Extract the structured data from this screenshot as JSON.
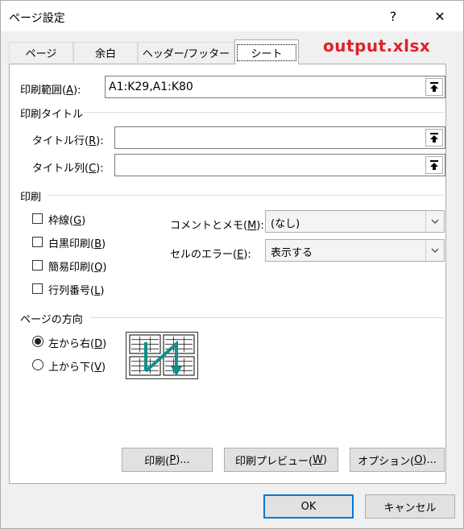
{
  "window": {
    "title": "ページ設定",
    "help_glyph": "?",
    "close_glyph": "✕"
  },
  "annotation": {
    "filename": "output.xlsx"
  },
  "tabs": [
    {
      "label": "ページ",
      "active": false
    },
    {
      "label": "余白",
      "active": false
    },
    {
      "label": "ヘッダー/フッター",
      "active": false
    },
    {
      "label": "シート",
      "active": true
    }
  ],
  "print_area": {
    "label_pre": "印刷範囲(",
    "accel": "A",
    "label_post": "):",
    "value": "A1:K29,A1:K80"
  },
  "print_titles": {
    "group_label": "印刷タイトル",
    "rows": {
      "label_pre": "タイトル行(",
      "accel": "R",
      "label_post": "):",
      "value": ""
    },
    "cols": {
      "label_pre": "タイトル列(",
      "accel": "C",
      "label_post": "):",
      "value": ""
    }
  },
  "print": {
    "group_label": "印刷",
    "options": [
      {
        "label_pre": "枠線(",
        "accel": "G",
        "label_post": ")",
        "checked": false
      },
      {
        "label_pre": "白黒印刷(",
        "accel": "B",
        "label_post": ")",
        "checked": false
      },
      {
        "label_pre": "簡易印刷(",
        "accel": "Q",
        "label_post": ")",
        "checked": false
      },
      {
        "label_pre": "行列番号(",
        "accel": "L",
        "label_post": ")",
        "checked": false
      }
    ],
    "comments": {
      "label_pre": "コメントとメモ(",
      "accel": "M",
      "label_post": "):",
      "value": "(なし)"
    },
    "errors": {
      "label_pre": "セルのエラー(",
      "accel": "E",
      "label_post": "):",
      "value": "表示する"
    }
  },
  "page_order": {
    "group_label": "ページの方向",
    "options": [
      {
        "label_pre": "左から右(",
        "accel": "D",
        "label_post": ")",
        "selected": true
      },
      {
        "label_pre": "上から下(",
        "accel": "V",
        "label_post": ")",
        "selected": false
      }
    ],
    "preview_colors": {
      "arrow": "#128f8b",
      "page": "#000000"
    }
  },
  "buttons": {
    "print": {
      "label_pre": "印刷(",
      "accel": "P",
      "label_post": ")..."
    },
    "print_preview": {
      "label_pre": "印刷プレビュー(",
      "accel": "W",
      "label_post": ")"
    },
    "options": {
      "label_pre": "オプション(",
      "accel": "O",
      "label_post": ")..."
    },
    "ok": "OK",
    "cancel": "キャンセル"
  },
  "colors": {
    "accent": "#0078d7",
    "annotation": "#e0202a"
  }
}
